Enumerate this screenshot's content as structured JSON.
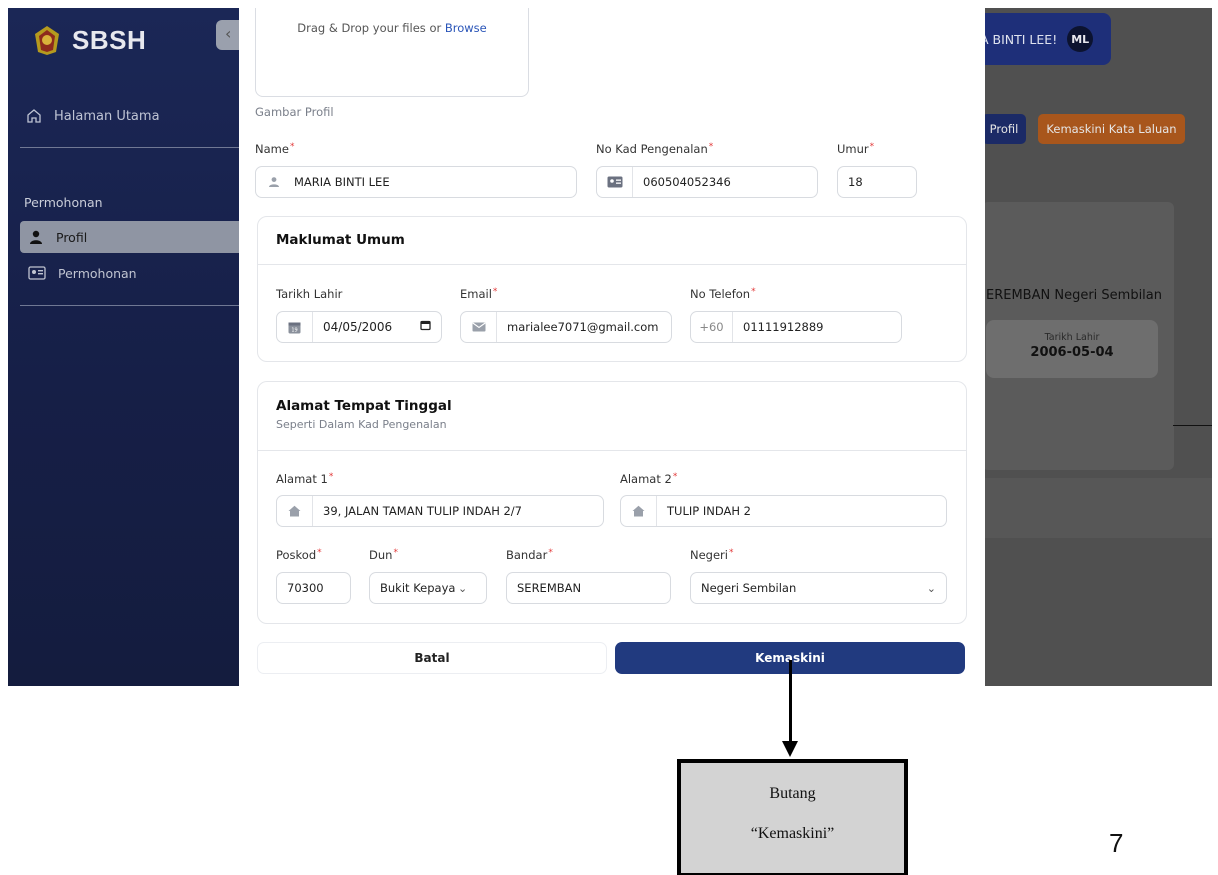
{
  "sidebar": {
    "logo_text": "SBSH",
    "home_label": "Halaman Utama",
    "section_label": "Permohonan",
    "items": [
      {
        "label": "Profil",
        "active": true
      },
      {
        "label": "Permohonan",
        "active": false
      }
    ]
  },
  "background": {
    "user_greeting": "A BINTI LEE!",
    "avatar_initials": "ML",
    "profile_button": "Profil",
    "update_password_button": "Kemaskini Kata Laluan",
    "address_text": "EREMBAN Negeri Sembilan",
    "dob_label": "Tarikh Lahir",
    "dob_value": "2006-05-04"
  },
  "modal": {
    "dropzone_text": "Drag & Drop your files or",
    "dropzone_link": "Browse",
    "profile_image_label": "Gambar Profil",
    "name_label": "Name",
    "name_value": "MARIA BINTI LEE",
    "ic_label": "No Kad Pengenalan",
    "ic_value": "060504052346",
    "age_label": "Umur",
    "age_value": "18",
    "general_section": {
      "title": "Maklumat Umum",
      "dob_label": "Tarikh Lahir",
      "dob_value": "04/05/2006",
      "email_label": "Email",
      "email_value": "marialee7071@gmail.com",
      "phone_label": "No Telefon",
      "phone_prefix": "+60",
      "phone_value": "01111912889"
    },
    "address_section": {
      "title": "Alamat Tempat Tinggal",
      "subtitle": "Seperti Dalam Kad Pengenalan",
      "address1_label": "Alamat 1",
      "address1_value": "39, JALAN TAMAN TULIP INDAH 2/7",
      "address2_label": "Alamat 2",
      "address2_value": "TULIP INDAH 2",
      "postcode_label": "Poskod",
      "postcode_value": "70300",
      "dun_label": "Dun",
      "dun_value": "Bukit Kepayang",
      "city_label": "Bandar",
      "city_value": "SEREMBAN",
      "state_label": "Negeri",
      "state_value": "Negeri Sembilan"
    },
    "cancel_button": "Batal",
    "update_button": "Kemaskini"
  },
  "annotation": {
    "line1": "Butang",
    "line2": "“Kemaskini”"
  },
  "page_number": "7",
  "colors": {
    "primary": "#213a7f",
    "sidebar": "#1b2756",
    "accent_orange": "#a8561c",
    "required": "#e23a3a",
    "link": "#2a55b8"
  }
}
